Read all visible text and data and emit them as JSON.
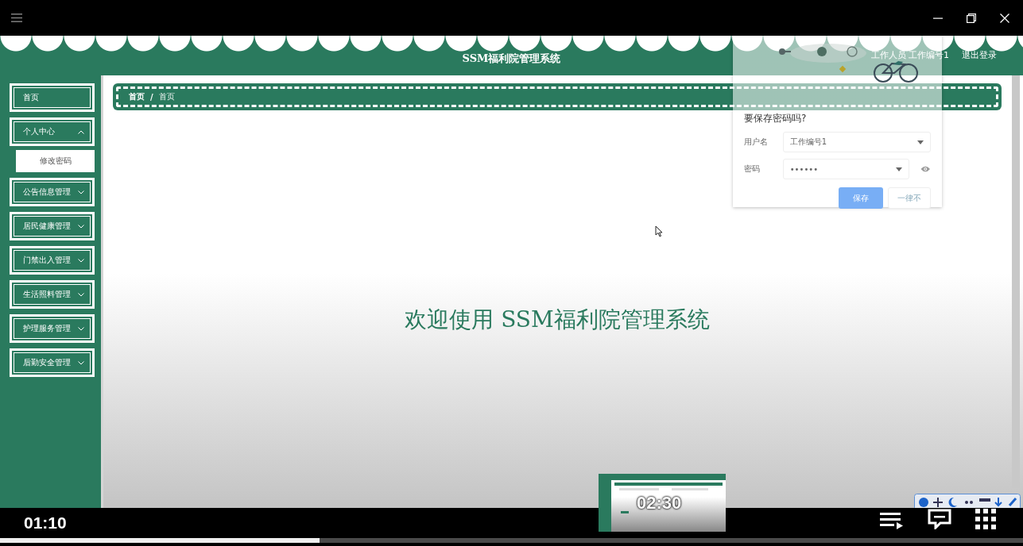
{
  "header": {
    "title": "SSM福利院管理系统",
    "user": "工作人员 工作编号1",
    "logout": "退出登录"
  },
  "sidebar": {
    "items": [
      {
        "label": "首页",
        "kind": "link"
      },
      {
        "label": "个人中心",
        "kind": "menu",
        "expanded": true,
        "children": [
          {
            "label": "修改密码"
          }
        ]
      },
      {
        "label": "公告信息管理",
        "kind": "menu",
        "expanded": false
      },
      {
        "label": "居民健康管理",
        "kind": "menu",
        "expanded": false
      },
      {
        "label": "门禁出入管理",
        "kind": "menu",
        "expanded": false
      },
      {
        "label": "生活照料管理",
        "kind": "menu",
        "expanded": false
      },
      {
        "label": "护理服务管理",
        "kind": "menu",
        "expanded": false
      },
      {
        "label": "后勤安全管理",
        "kind": "menu",
        "expanded": false
      }
    ]
  },
  "breadcrumb": {
    "separator": "/",
    "items": [
      {
        "label": "首页",
        "current": false
      },
      {
        "label": "首页",
        "current": true
      }
    ]
  },
  "welcome": "欢迎使用 SSM福利院管理系统",
  "save_password_dialog": {
    "title": "要保存密码吗?",
    "fields": [
      {
        "label": "用户名",
        "value": "工作编号1",
        "kind": "text"
      },
      {
        "label": "密码",
        "value": "••••••",
        "kind": "password"
      }
    ],
    "buttons": [
      {
        "label": "保存",
        "kind": "primary"
      },
      {
        "label": "一律不",
        "kind": "secondary"
      }
    ]
  },
  "player": {
    "current_time": "01:10",
    "progress": {
      "level": 0.312
    },
    "preview": {
      "time": "02:30"
    }
  }
}
